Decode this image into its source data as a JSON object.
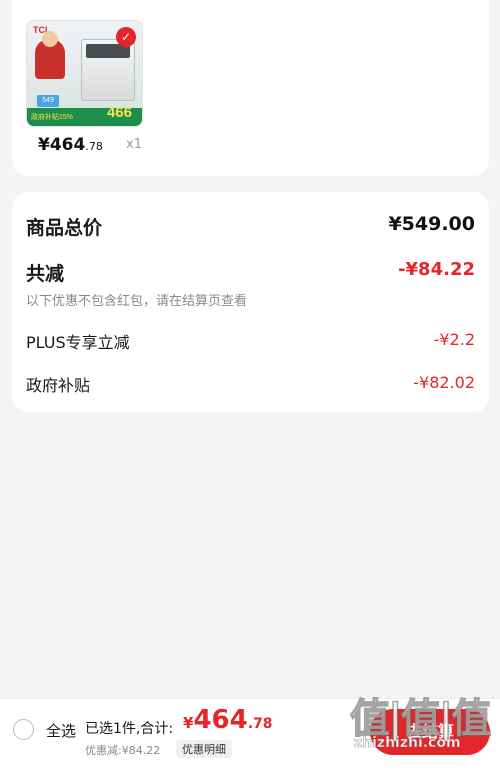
{
  "item": {
    "brand": "TCL",
    "thumbnail_price_tag": "549",
    "thumbnail_strip_text": "政府补贴15%",
    "thumbnail_big_price": "466",
    "price_symbol": "¥",
    "price_int": "464",
    "price_dec": ".78",
    "quantity": "x1"
  },
  "summary": {
    "total_label": "商品总价",
    "total_value": "¥549.00",
    "reduce_label": "共减",
    "reduce_value": "-¥84.22",
    "reduce_note": "以下优惠不包含红包，请在结算页查看",
    "plus_label": "PLUS专享立减",
    "plus_value": "-¥2.2",
    "gov_label": "政府补贴",
    "gov_value": "-¥82.02"
  },
  "bottom": {
    "select_all": "全选",
    "summary_text": "已选1件,合计:",
    "total_symbol": "¥",
    "total_int": "464",
    "total_dec": ".78",
    "discount_text": "优惠减:¥84.22",
    "detail_label": "优惠明细",
    "checkout_label": "去结算"
  },
  "watermark": {
    "big": "值|值|值",
    "small": "zhizhizhi.com"
  },
  "colors": {
    "accent": "#e4262a",
    "background": "#f4f4f4",
    "card": "#ffffff"
  }
}
